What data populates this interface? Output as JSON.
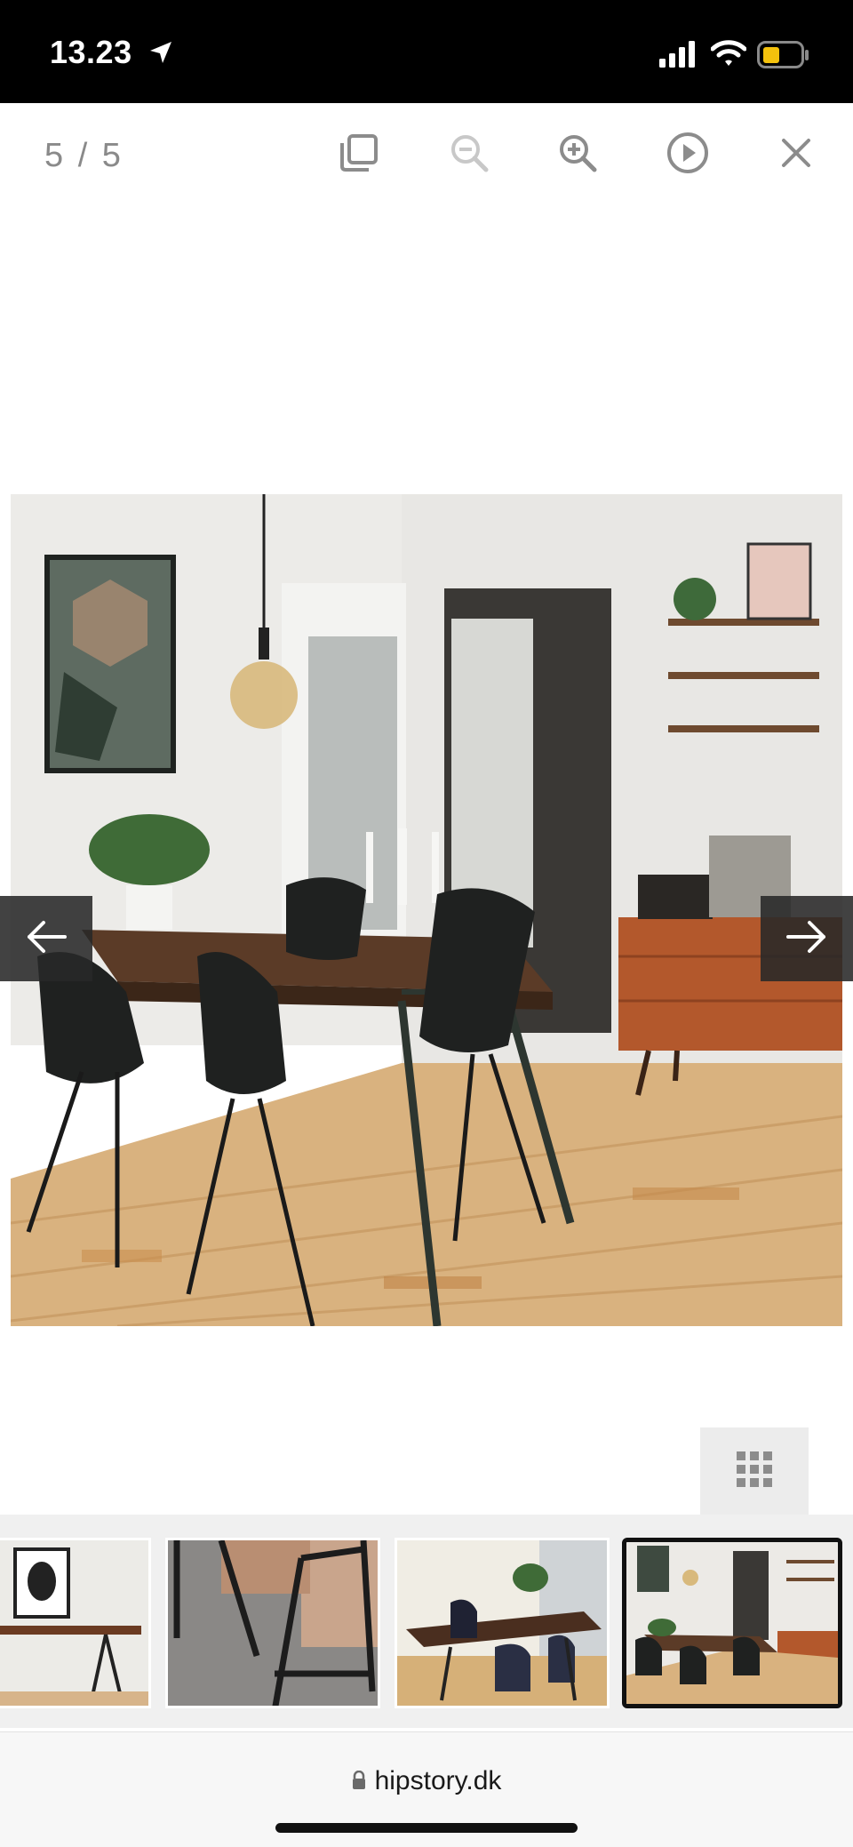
{
  "status_bar": {
    "time": "13.23",
    "icons": [
      "location-arrow-icon",
      "cellular-signal-icon",
      "wifi-icon",
      "battery-icon"
    ],
    "battery_color": "#f4c20d"
  },
  "toolbar": {
    "counter": "5 / 5",
    "buttons": [
      "fullscreen-icon",
      "zoom-out-icon",
      "zoom-in-icon",
      "play-icon",
      "close-icon"
    ]
  },
  "viewer": {
    "prev_icon": "arrow-left-icon",
    "next_icon": "arrow-right-icon",
    "grid_icon": "grid-icon"
  },
  "thumbnails": {
    "count": 4,
    "active_index": 3
  },
  "browser": {
    "url": "hipstory.dk",
    "lock_icon": "lock-icon"
  },
  "colors": {
    "toolbar_icon": "#8c8c8c",
    "toolbar_icon_disabled": "#c8c8c8",
    "arrow_bg": "#282828",
    "thumb_strip_bg": "#f0f0f0"
  }
}
